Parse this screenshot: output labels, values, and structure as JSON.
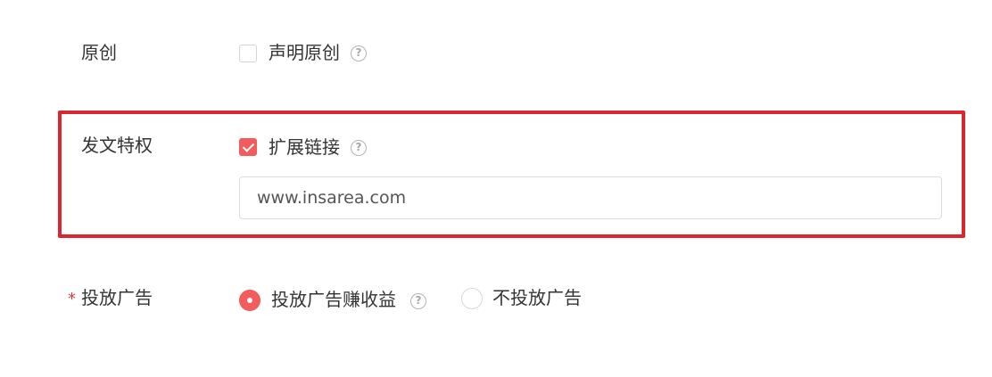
{
  "original": {
    "label": "原创",
    "checkbox_label": "声明原创",
    "checked": false
  },
  "privilege": {
    "label": "发文特权",
    "checkbox_label": "扩展链接",
    "checked": true,
    "link_value": "www.insarea.com"
  },
  "ads": {
    "required_mark": "*",
    "label": "投放广告",
    "options": [
      {
        "label": "投放广告赚收益",
        "selected": true
      },
      {
        "label": "不投放广告",
        "selected": false
      }
    ]
  },
  "help_glyph": "?",
  "colors": {
    "accent": "#f25c5c",
    "highlight_border": "#d9262f",
    "required": "#e5393f"
  }
}
